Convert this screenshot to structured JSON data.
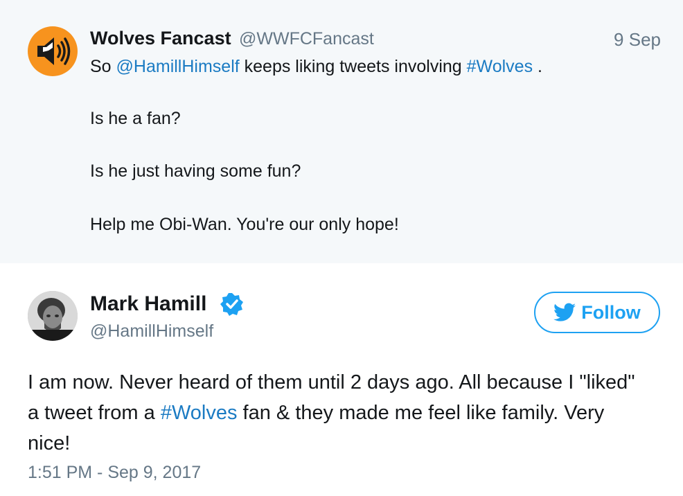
{
  "parent_tweet": {
    "name": "Wolves Fancast",
    "handle": "@WWFCFancast",
    "date": "9 Sep",
    "line1": {
      "prefix": "So ",
      "mention": "@HamillHimself",
      "middle": " keeps liking tweets involving ",
      "hashtag": "#Wolves",
      "suffix": " ."
    },
    "line2": "Is he a fan?",
    "line3": "Is he just having some fun?",
    "line4": "Help me Obi-Wan. You're our only hope!"
  },
  "main_tweet": {
    "name": "Mark Hamill",
    "handle": "@HamillHimself",
    "follow_label": "Follow",
    "text_before": "I am now. Never heard of them until 2 days ago. All because I \"liked\" a tweet from a ",
    "hashtag": "#Wolves",
    "text_after": " fan & they made me feel like family. Very nice!",
    "timestamp": "1:51 PM - Sep 9, 2017"
  },
  "colors": {
    "link": "#1b7bc3",
    "twitter_blue": "#1da1f2",
    "parent_bg": "#f5f8fa",
    "avatar_orange": "#f7931e"
  },
  "icons": [
    "speaker-icon",
    "verified-badge-icon",
    "twitter-bird-icon"
  ]
}
